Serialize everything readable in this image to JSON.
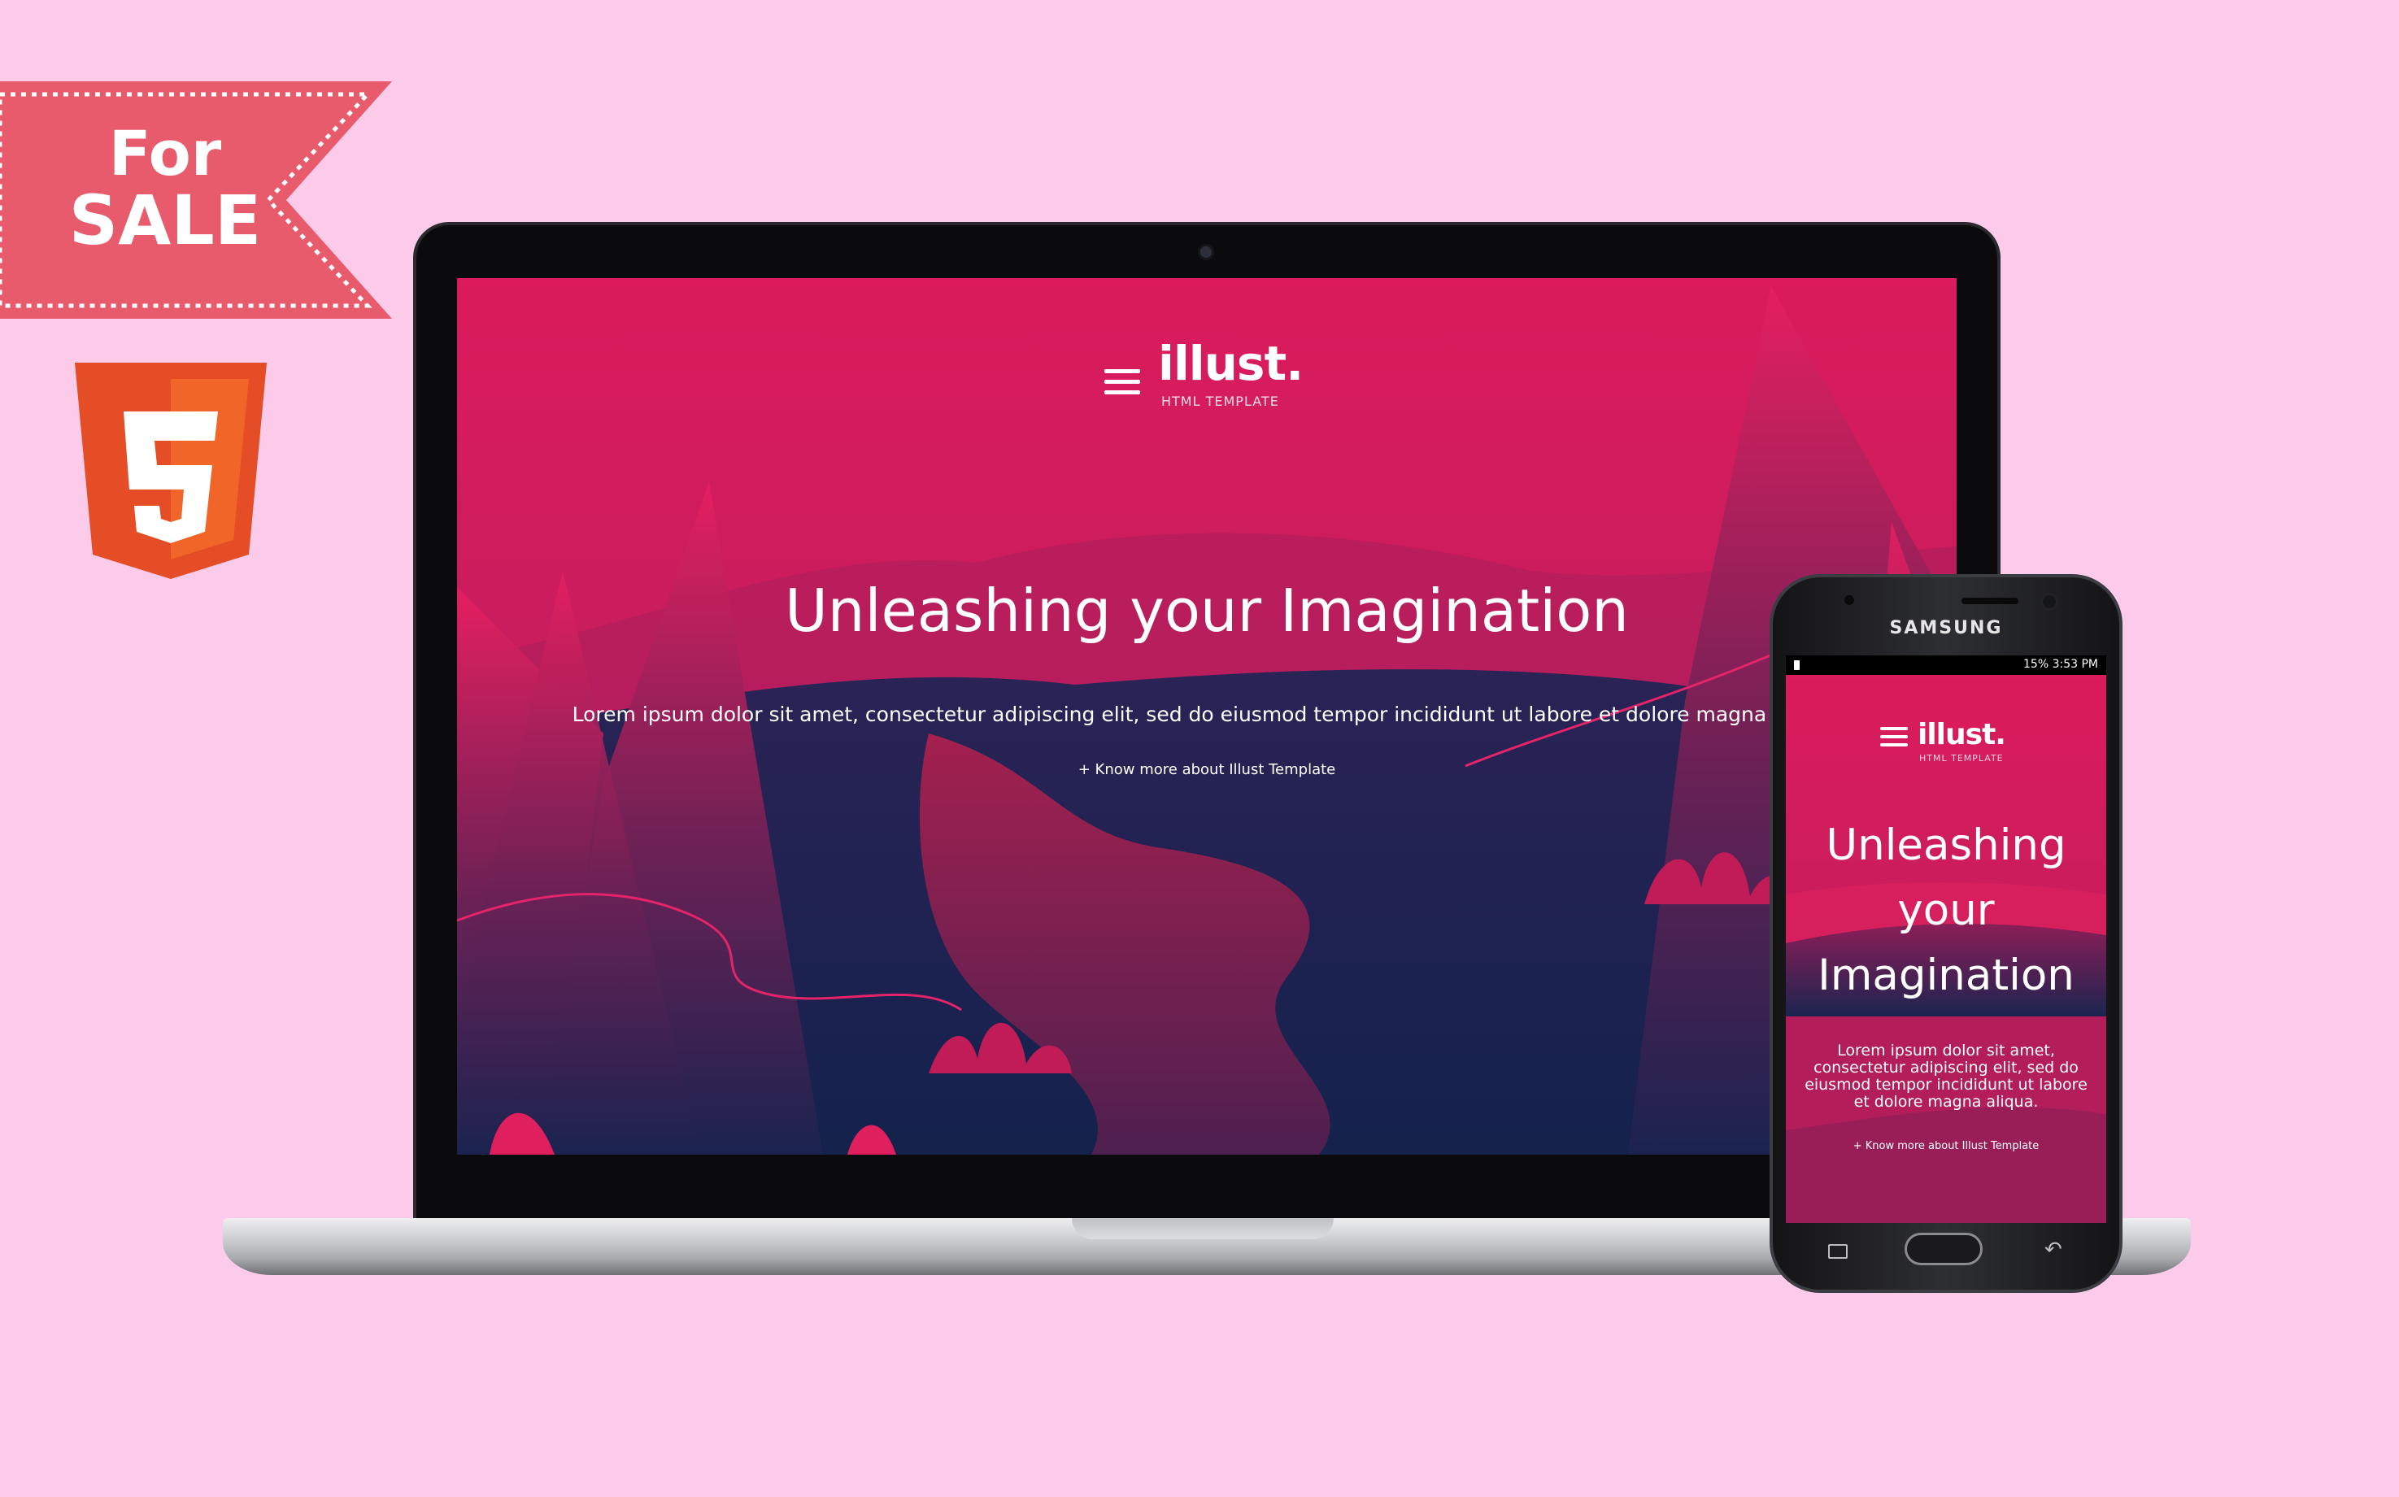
{
  "ribbon": {
    "line1": "For",
    "line2": "SALE",
    "color": "#e85b6c"
  },
  "badge": {
    "icon": "html5-icon",
    "number": "5",
    "color": "#e44d26"
  },
  "laptop": {
    "logo": "illust.",
    "logo_sub": "HTML TEMPLATE",
    "headline": "Unleashing your Imagination",
    "body": "Lorem ipsum dolor sit amet, consectetur adipiscing elit, sed do eiusmod tempor incididunt ut labore et dolore magna aliqua.",
    "link": "+ Know more about Illust Template"
  },
  "phone": {
    "brand": "SAMSUNG",
    "status": "15% 3:53 PM",
    "logo": "illust.",
    "logo_sub": "HTML TEMPLATE",
    "headline_line1": "Unleashing",
    "headline_line2": "your",
    "headline_line3": "Imagination",
    "body": "Lorem ipsum dolor sit amet, consectetur adipiscing elit, sed do eiusmod tempor incididunt ut labore et dolore magna aliqua.",
    "link": "+ Know more about Illust Template"
  },
  "colors": {
    "background": "#fbcbe9",
    "accent": "#d61c59",
    "dark": "#1a2450"
  }
}
